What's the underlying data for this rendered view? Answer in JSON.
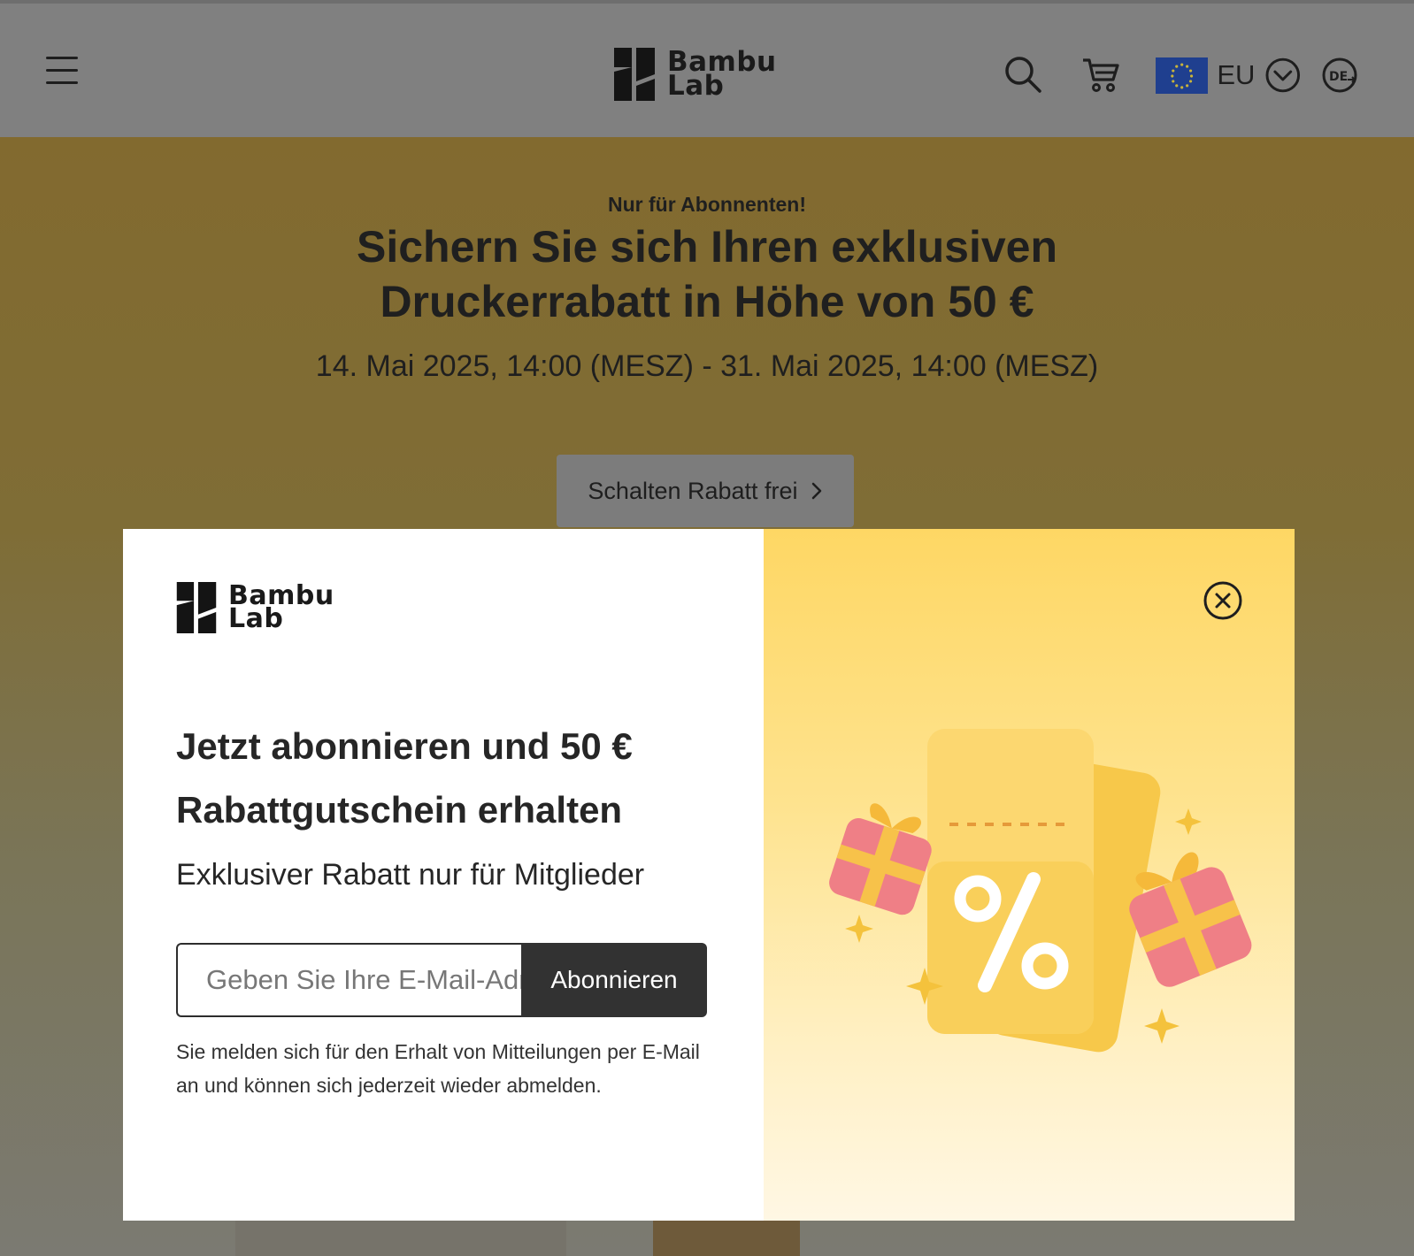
{
  "header": {
    "logo_line1": "Bambu",
    "logo_line2": "Lab",
    "region_label": "EU"
  },
  "hero": {
    "kicker": "Nur für Abonnenten!",
    "title_line1": "Sichern Sie sich Ihren exklusiven",
    "title_line2": "Druckerrabatt in Höhe von 50 €",
    "dates": "14. Mai 2025, 14:00 (MESZ) - 31. Mai 2025, 14:00 (MESZ)",
    "cta_label": "Schalten Rabatt frei",
    "cta_icon": "chevron-right-icon"
  },
  "modal": {
    "logo_line1": "Bambu",
    "logo_line2": "Lab",
    "headline_line1": "Jetzt abonnieren und 50 €",
    "headline_line2": "Rabattgutschein erhalten",
    "subheadline": "Exklusiver Rabatt nur für Mitglieder",
    "email_placeholder": "Geben Sie Ihre E-Mail-Adresse ein",
    "subscribe_label": "Abonnieren",
    "disclaimer": "Sie melden sich für den Erhalt von Mitteilungen per E-Mail an und können sich jederzeit wieder abmelden.",
    "close_icon": "close-icon",
    "art_icon": "coupon-gift-illustration"
  },
  "colors": {
    "brand_dark": "#1a1a1a",
    "button_dark": "#323232",
    "promo_yellow": "#fed764",
    "eu_blue": "#1f3f8f"
  }
}
